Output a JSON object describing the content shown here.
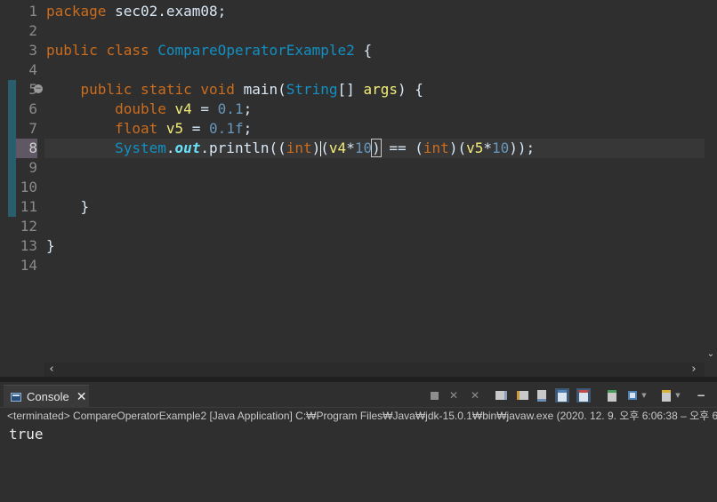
{
  "editor": {
    "line_numbers": [
      "1",
      "2",
      "3",
      "4",
      "5",
      "6",
      "7",
      "8",
      "9",
      "10",
      "11",
      "12",
      "13",
      "14"
    ],
    "active_line": "8",
    "lines": [
      [
        {
          "t": "package",
          "c": "kw"
        },
        {
          "t": " sec02.exam08;",
          "c": "txt"
        }
      ],
      [],
      [
        {
          "t": "public",
          "c": "kw"
        },
        {
          "t": " ",
          "c": "txt"
        },
        {
          "t": "class",
          "c": "kw"
        },
        {
          "t": " ",
          "c": "txt"
        },
        {
          "t": "CompareOperatorExample2",
          "c": "cls"
        },
        {
          "t": " {",
          "c": "txt"
        }
      ],
      [],
      [
        {
          "t": "    ",
          "c": "txt"
        },
        {
          "t": "public",
          "c": "kw"
        },
        {
          "t": " ",
          "c": "txt"
        },
        {
          "t": "static",
          "c": "kw"
        },
        {
          "t": " ",
          "c": "txt"
        },
        {
          "t": "void",
          "c": "kw"
        },
        {
          "t": " main(",
          "c": "txt"
        },
        {
          "t": "String",
          "c": "cls"
        },
        {
          "t": "[] ",
          "c": "txt"
        },
        {
          "t": "args",
          "c": "var"
        },
        {
          "t": ") {",
          "c": "txt"
        }
      ],
      [
        {
          "t": "        ",
          "c": "txt"
        },
        {
          "t": "double",
          "c": "kw"
        },
        {
          "t": " ",
          "c": "txt"
        },
        {
          "t": "v4",
          "c": "var"
        },
        {
          "t": " = ",
          "c": "txt"
        },
        {
          "t": "0.1",
          "c": "num"
        },
        {
          "t": ";",
          "c": "txt"
        }
      ],
      [
        {
          "t": "        ",
          "c": "txt"
        },
        {
          "t": "float",
          "c": "kw"
        },
        {
          "t": " ",
          "c": "txt"
        },
        {
          "t": "v5",
          "c": "var"
        },
        {
          "t": " = ",
          "c": "txt"
        },
        {
          "t": "0.1f",
          "c": "num"
        },
        {
          "t": ";",
          "c": "txt"
        }
      ],
      [
        {
          "t": "        ",
          "c": "txt"
        },
        {
          "t": "System",
          "c": "cls"
        },
        {
          "t": ".",
          "c": "txt"
        },
        {
          "t": "out",
          "c": "fld"
        },
        {
          "t": ".println((",
          "c": "txt"
        },
        {
          "t": "int",
          "c": "kw"
        },
        {
          "t": ")",
          "c": "txt"
        },
        {
          "t": "(",
          "c": "txt",
          "caret": true
        },
        {
          "t": "v4",
          "c": "var"
        },
        {
          "t": "*",
          "c": "txt"
        },
        {
          "t": "10",
          "c": "num"
        },
        {
          "t": ")",
          "c": "txt",
          "box": true
        },
        {
          "t": " == (",
          "c": "txt"
        },
        {
          "t": "int",
          "c": "kw"
        },
        {
          "t": ")(",
          "c": "txt"
        },
        {
          "t": "v5",
          "c": "var"
        },
        {
          "t": "*",
          "c": "txt"
        },
        {
          "t": "10",
          "c": "num"
        },
        {
          "t": "));",
          "c": "txt"
        }
      ],
      [],
      [],
      [
        {
          "t": "    }",
          "c": "txt"
        }
      ],
      [],
      [
        {
          "t": "}",
          "c": "txt"
        }
      ],
      []
    ],
    "scroll_left_glyph": "‹",
    "scroll_right_glyph": "›",
    "scroll_down_glyph": "⌄",
    "fold_glyph": "−"
  },
  "console": {
    "tab_label": "Console",
    "close_glyph": "✕",
    "status": "<terminated> CompareOperatorExample2 [Java Application] C:₩Program Files₩Java₩jdk-15.0.1₩bin₩javaw.exe  (2020. 12. 9. 오후 6:06:38 – 오후 6",
    "output": "true",
    "toolbar_icons": [
      "terminate-icon",
      "remove-launch-icon",
      "remove-all-terminated-icon",
      "clear-console-icon",
      "scroll-lock-icon",
      "word-wrap-icon",
      "show-stdout-icon",
      "show-stderr-icon",
      "pin-console-icon",
      "display-console-icon",
      "open-console-icon",
      "minimize-icon"
    ]
  }
}
